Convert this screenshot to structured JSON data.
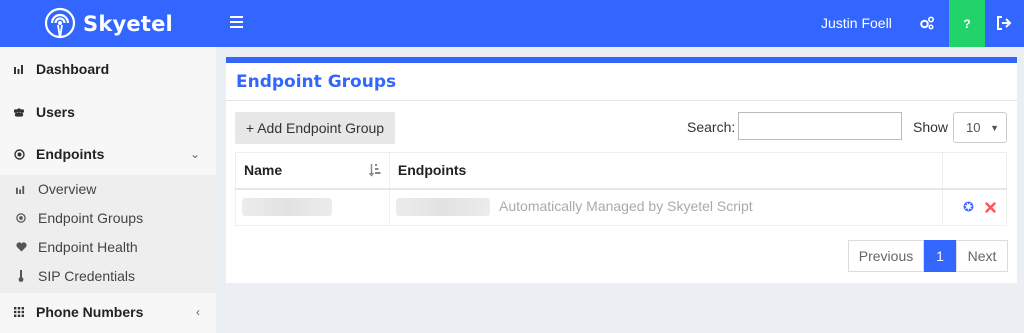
{
  "brand": {
    "name": "Skyetel"
  },
  "topbar": {
    "username": "Justin Foell",
    "help_label": "?"
  },
  "icons": {
    "menu": "hamburger-icon",
    "settings": "cogs-icon",
    "help": "question-icon",
    "logout": "sign-out-icon",
    "dashboard": "bar-chart-icon",
    "users": "users-icon",
    "endpoints": "dot-circle-icon",
    "overview": "bar-chart-icon",
    "endpoint_groups": "dot-circle-icon",
    "endpoint_health": "heart-icon",
    "sip_credentials": "thermometer-icon",
    "phone_numbers": "grid-icon"
  },
  "colors": {
    "primary": "#3366ff",
    "help_bg": "#22d36a",
    "delete": "#ff5555",
    "edit": "#3366ff"
  },
  "sidebar": {
    "items": [
      {
        "label": "Dashboard"
      },
      {
        "label": "Users"
      },
      {
        "label": "Endpoints",
        "chevron": "⌄"
      },
      {
        "label": "Phone Numbers",
        "chevron": "‹"
      }
    ],
    "subitems": [
      {
        "label": "Overview"
      },
      {
        "label": "Endpoint Groups"
      },
      {
        "label": "Endpoint Health"
      },
      {
        "label": "SIP Credentials"
      }
    ]
  },
  "main": {
    "title": "Endpoint Groups",
    "add_button": "+ Add Endpoint Group",
    "search_label": "Search:",
    "search_value": "",
    "show_label": "Show",
    "show_value": "10",
    "table": {
      "columns": [
        "Name",
        "Endpoints"
      ],
      "rows": [
        {
          "name": "",
          "endpoints_note": "Automatically Managed by Skyetel Script"
        }
      ]
    },
    "pagination": {
      "previous": "Previous",
      "current": "1",
      "next": "Next"
    }
  }
}
